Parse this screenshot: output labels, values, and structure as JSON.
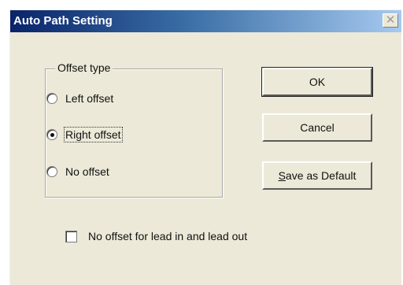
{
  "dialog": {
    "title": "Auto Path Setting",
    "close_glyph": "✕"
  },
  "offset_group": {
    "label": "Offset type",
    "options": [
      {
        "label": "Left offset",
        "checked": false
      },
      {
        "label": "Right offset",
        "checked": true
      },
      {
        "label": "No offset",
        "checked": false
      }
    ]
  },
  "buttons": {
    "ok": "OK",
    "cancel": "Cancel",
    "save_default": "Save as Default"
  },
  "checkbox": {
    "label": "No offset for lead in and lead out",
    "checked": false
  },
  "colors": {
    "titlebar_start": "#0a246a",
    "titlebar_end": "#a6caf0",
    "dialog_face": "#ece9d8"
  },
  "icons": {
    "close": "close-icon",
    "radio": "radio-icon",
    "checkbox": "checkbox-icon"
  }
}
